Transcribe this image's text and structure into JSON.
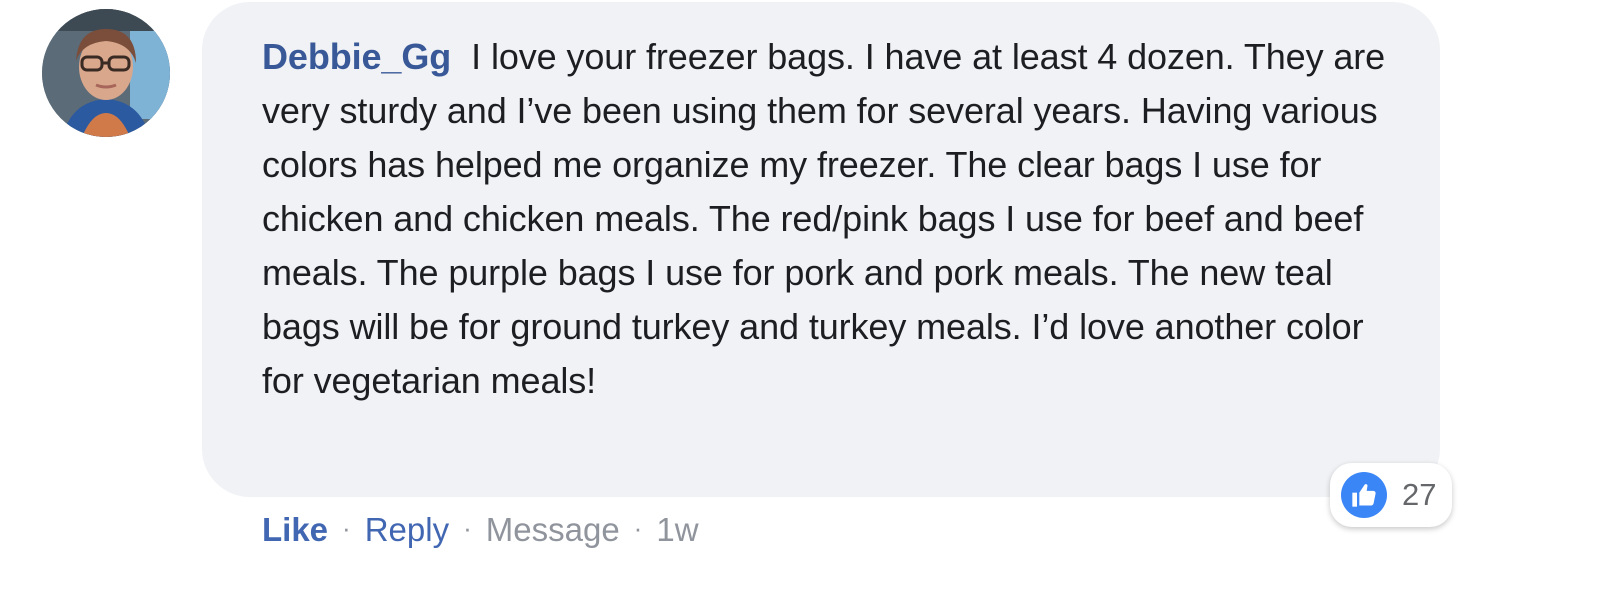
{
  "comment": {
    "author": "Debbie_Gg",
    "text": "I love your freezer bags. I have at least 4 dozen. They are very sturdy and I’ve been using them for several years. Having various colors has helped me organize my freezer. The clear bags I use for chicken and chicken meals. The red/pink bags I use for beef and beef meals. The purple bags I use for pork and pork meals. The new teal bags will be for ground turkey and turkey meals. I’d love another color for vegetarian meals!",
    "reaction_icon": "thumbs-up-icon",
    "reaction_count": "27",
    "bubble_color": "#f0f2f5",
    "author_color": "#385898",
    "like_color": "#3b86f7"
  },
  "actions": {
    "like_label": "Like",
    "reply_label": "Reply",
    "message_label": "Message",
    "separator": "·",
    "timestamp": "1w"
  }
}
